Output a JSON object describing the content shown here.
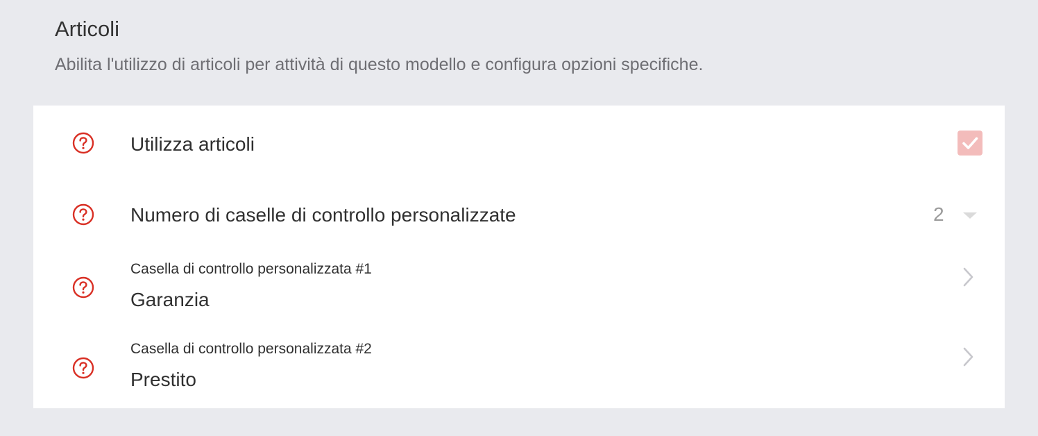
{
  "section": {
    "title": "Articoli",
    "description": "Abilita l'utilizzo di articoli per attività di questo modello e configura opzioni specifiche."
  },
  "settings": {
    "use_items": {
      "label": "Utilizza articoli",
      "checked": true,
      "icon": "help-circle-icon"
    },
    "custom_checkbox_count": {
      "label": "Numero di caselle di controllo personalizzate",
      "value": "2",
      "icon": "help-circle-icon"
    },
    "custom_checkboxes": [
      {
        "label": "Casella di controllo personalizzata #1",
        "value": "Garanzia"
      },
      {
        "label": "Casella di controllo personalizzata #2",
        "value": "Prestito"
      }
    ]
  },
  "colors": {
    "accent": "#d93025",
    "checkbox_fill": "#f3bcbb",
    "background": "#e9eaee"
  }
}
